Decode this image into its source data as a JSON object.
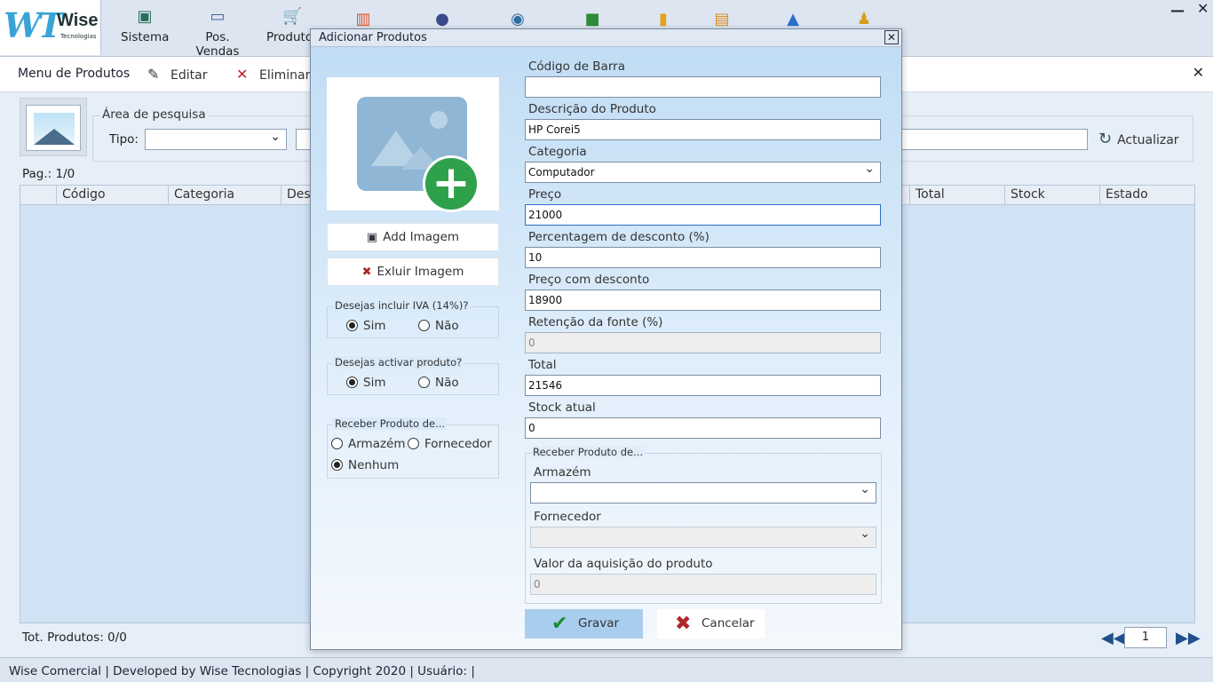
{
  "ribbon": {
    "logo_text": "Wise",
    "logo_sub": "Tecnologias",
    "items": [
      {
        "label": "Sistema",
        "icon": "monitor-pulse-icon"
      },
      {
        "label": "Pos. Vendas",
        "icon": "laptop-icon"
      },
      {
        "label": "Produtos",
        "icon": "cart-icon"
      }
    ],
    "extra_icons": [
      "report-icon",
      "user-icon",
      "users-icon",
      "truck-icon",
      "bar-chart-icon",
      "shopping-icon",
      "trend-chart-icon",
      "person-icon"
    ]
  },
  "menubar": {
    "title": "Menu de Produtos",
    "edit_label": "Editar",
    "delete_label": "Eliminar"
  },
  "search": {
    "group_label": "Área de pesquisa",
    "type_label": "Tipo:",
    "type_value": "",
    "query_value": "",
    "refresh_label": "Actualizar"
  },
  "page_info": "Pag.: 1/0",
  "table": {
    "columns": [
      "Código",
      "Categoria",
      "Des",
      "Total",
      "Stock",
      "Estado"
    ]
  },
  "total_products": "Tot. Produtos: 0/0",
  "pager": {
    "page": "1"
  },
  "status_bar": "Wise Comercial | Developed by Wise Tecnologias | Copyright 2020 | Usuário:   |",
  "dialog": {
    "title": "Adicionar Produtos",
    "add_image_label": "Add Imagem",
    "delete_image_label": "Exluir Imagem",
    "iva_group": {
      "label": "Desejas incluir IVA (14%)?",
      "yes": "Sim",
      "no": "Não",
      "selected": "Sim"
    },
    "activate_group": {
      "label": "Desejas activar produto?",
      "yes": "Sim",
      "no": "Não",
      "selected": "Sim"
    },
    "receive_group": {
      "label": "Receber Produto de...",
      "options": [
        "Armazém",
        "Fornecedor",
        "Nenhum"
      ],
      "selected": "Nenhum"
    },
    "fields": {
      "barcode": {
        "label": "Código de Barra",
        "value": ""
      },
      "description": {
        "label": "Descrição do Produto",
        "value": "HP Corei5"
      },
      "category": {
        "label": "Categoria",
        "value": "Computador"
      },
      "price": {
        "label": "Preço",
        "value": "21000"
      },
      "discount_pct": {
        "label": "Percentagem de desconto (%)",
        "value": "10"
      },
      "discounted_price": {
        "label": "Preço com desconto",
        "value": "18900"
      },
      "withholding": {
        "label": "Retenção da fonte (%)",
        "value": "0"
      },
      "total": {
        "label": "Total",
        "value": "21546"
      },
      "stock": {
        "label": "Stock atual",
        "value": "0"
      }
    },
    "receive_panel": {
      "label": "Receber Produto de...",
      "warehouse_label": "Armazém",
      "warehouse_value": "",
      "supplier_label": "Fornecedor",
      "supplier_value": "",
      "acq_label": "Valor da aquisição do produto",
      "acq_value": "0"
    },
    "save_label": "Gravar",
    "cancel_label": "Cancelar"
  },
  "colors": {
    "accent": "#a9cdee",
    "ok_green": "#1d8a2f",
    "cancel_red": "#b0262b"
  }
}
